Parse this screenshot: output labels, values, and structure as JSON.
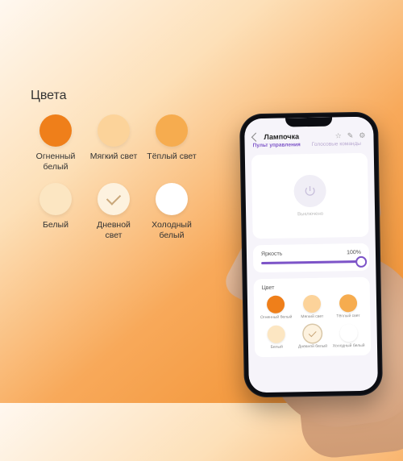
{
  "palette": {
    "title": "Цвета",
    "items": [
      {
        "label": "Огненный белый",
        "color": "#ef7f1a",
        "selected": false
      },
      {
        "label": "Мягкий свет",
        "color": "#fcd39a",
        "selected": false
      },
      {
        "label": "Тёплый свет",
        "color": "#f6ac4f",
        "selected": false
      },
      {
        "label": "Белый",
        "color": "#fce6c2",
        "selected": false
      },
      {
        "label": "Дневной свет",
        "color": "#fdf2df",
        "selected": true
      },
      {
        "label": "Холодный белый",
        "color": "#ffffff",
        "selected": false
      }
    ]
  },
  "phone": {
    "title": "Лампочка",
    "tabs": {
      "active": "Пульт управления",
      "inactive": "Голосовые команды"
    },
    "power_label": "Выключено",
    "brightness": {
      "label": "Яркость",
      "value_text": "100%"
    },
    "colors_title": "Цвет",
    "colors": [
      {
        "label": "Огненный белый",
        "color": "#ef7f1a",
        "selected": false
      },
      {
        "label": "Мягкий свет",
        "color": "#fcd39a",
        "selected": false
      },
      {
        "label": "Тёплый свет",
        "color": "#f6ac4f",
        "selected": false
      },
      {
        "label": "Белый",
        "color": "#fce6c2",
        "selected": false
      },
      {
        "label": "Дневной белый",
        "color": "#fdf2df",
        "selected": true
      },
      {
        "label": "Холодный белый",
        "color": "#ffffff",
        "selected": false
      }
    ]
  }
}
